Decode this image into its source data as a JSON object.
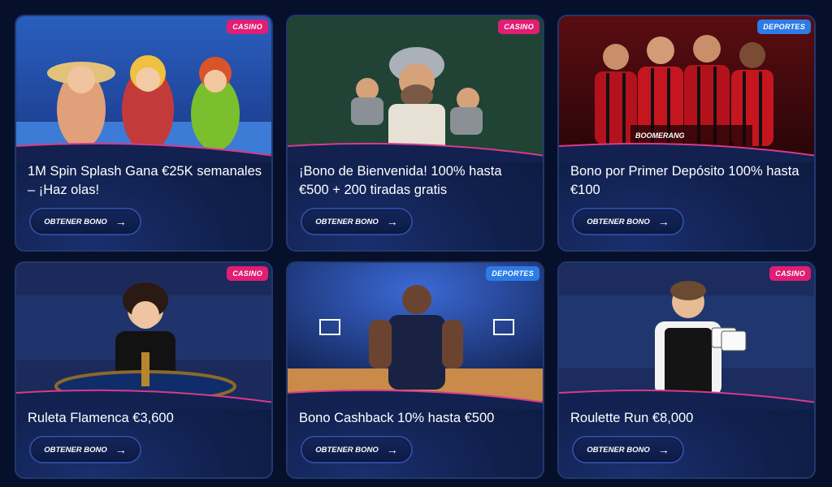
{
  "offers": [
    {
      "tag": "CASINO",
      "title": "1M Spin Splash Gana €25K semanales – ¡Haz olas!",
      "button": "OBTENER BONO"
    },
    {
      "tag": "CASINO",
      "title": "¡Bono de Bienvenida! 100% hasta €500 + 200 tiradas gratis",
      "button": "OBTENER BONO"
    },
    {
      "tag": "DEPORTES",
      "title": "Bono por Primer Depósito 100% hasta €100",
      "button": "OBTENER BONO",
      "sponsor_text": "BOOMERANG"
    },
    {
      "tag": "CASINO",
      "title": "Ruleta Flamenca €3,600",
      "button": "OBTENER BONO"
    },
    {
      "tag": "DEPORTES",
      "title": "Bono Cashback 10% hasta €500",
      "button": "OBTENER BONO"
    },
    {
      "tag": "CASINO",
      "title": "Roulette Run €8,000",
      "button": "OBTENER BONO"
    }
  ],
  "icons": {
    "button_icon": "arrow-right-icon"
  },
  "colors": {
    "casino_tag": "#e11d74",
    "deportes_tag": "#2d7be6",
    "background": "#07102a"
  }
}
